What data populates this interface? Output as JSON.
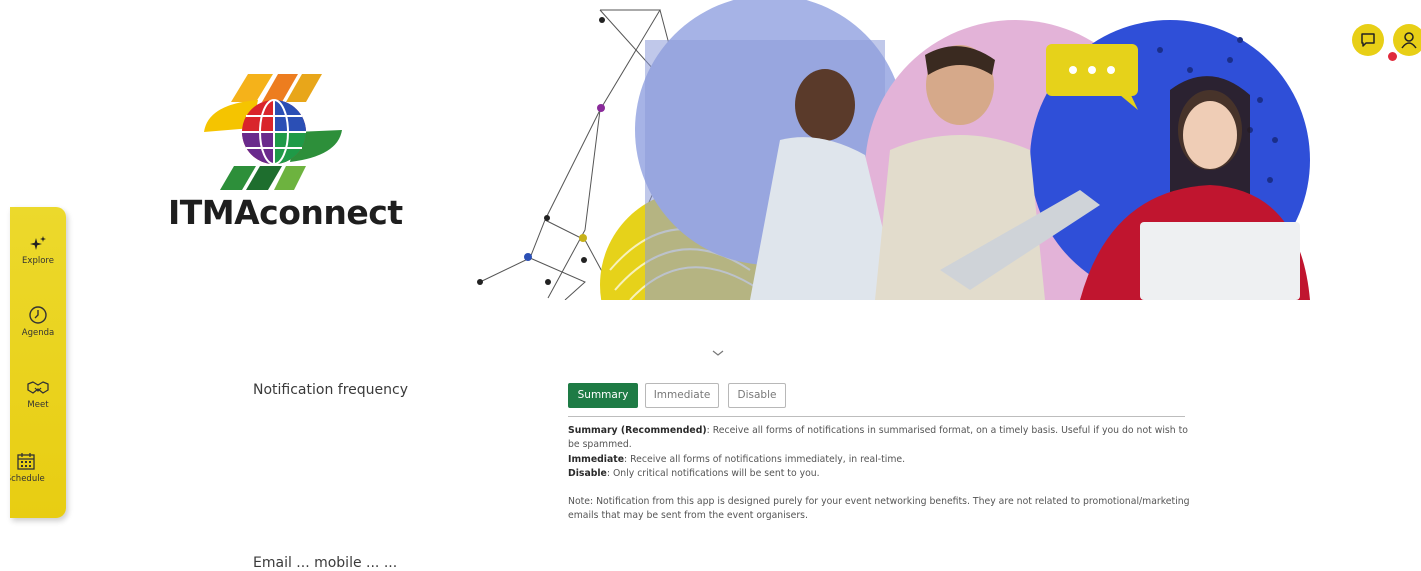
{
  "brand": {
    "logo_text": "ITMAconnect"
  },
  "header": {
    "chat_icon": "chat-bubble-icon",
    "user_icon": "user-profile-icon",
    "notification_dot_color": "#e02b3c"
  },
  "sidebar": {
    "items": [
      {
        "label": "Explore",
        "icon": "sparkles-icon"
      },
      {
        "label": "Agenda",
        "icon": "clock-icon"
      },
      {
        "label": "Meet",
        "icon": "handshake-icon"
      },
      {
        "label": "y Schedule",
        "icon": "calendar-icon"
      }
    ]
  },
  "settings": {
    "frequency_label": "Notification frequency",
    "options": [
      "Summary",
      "Immediate",
      "Disable"
    ],
    "selected": "Summary",
    "descriptions": {
      "summary_title": "Summary (Recommended)",
      "summary_text": ": Receive all forms of notifications in summarised format, on a timely basis. Useful if you do not wish to be spammed.",
      "immediate_title": "Immediate",
      "immediate_text": ": Receive all forms of notifications immediately, in real-time.",
      "disable_title": "Disable",
      "disable_text": ": Only critical notifications will be sent to you.",
      "note": "Note: Notification from this app is designed purely for your event networking benefits. They are not related to promotional/marketing emails that may be sent from the event organisers."
    },
    "next_label": "Email ... mobile ... ..."
  },
  "colors": {
    "accent": "#1e7b45",
    "nav_bg": "#e8cd12",
    "hero_blue": "#2f4fd8"
  }
}
